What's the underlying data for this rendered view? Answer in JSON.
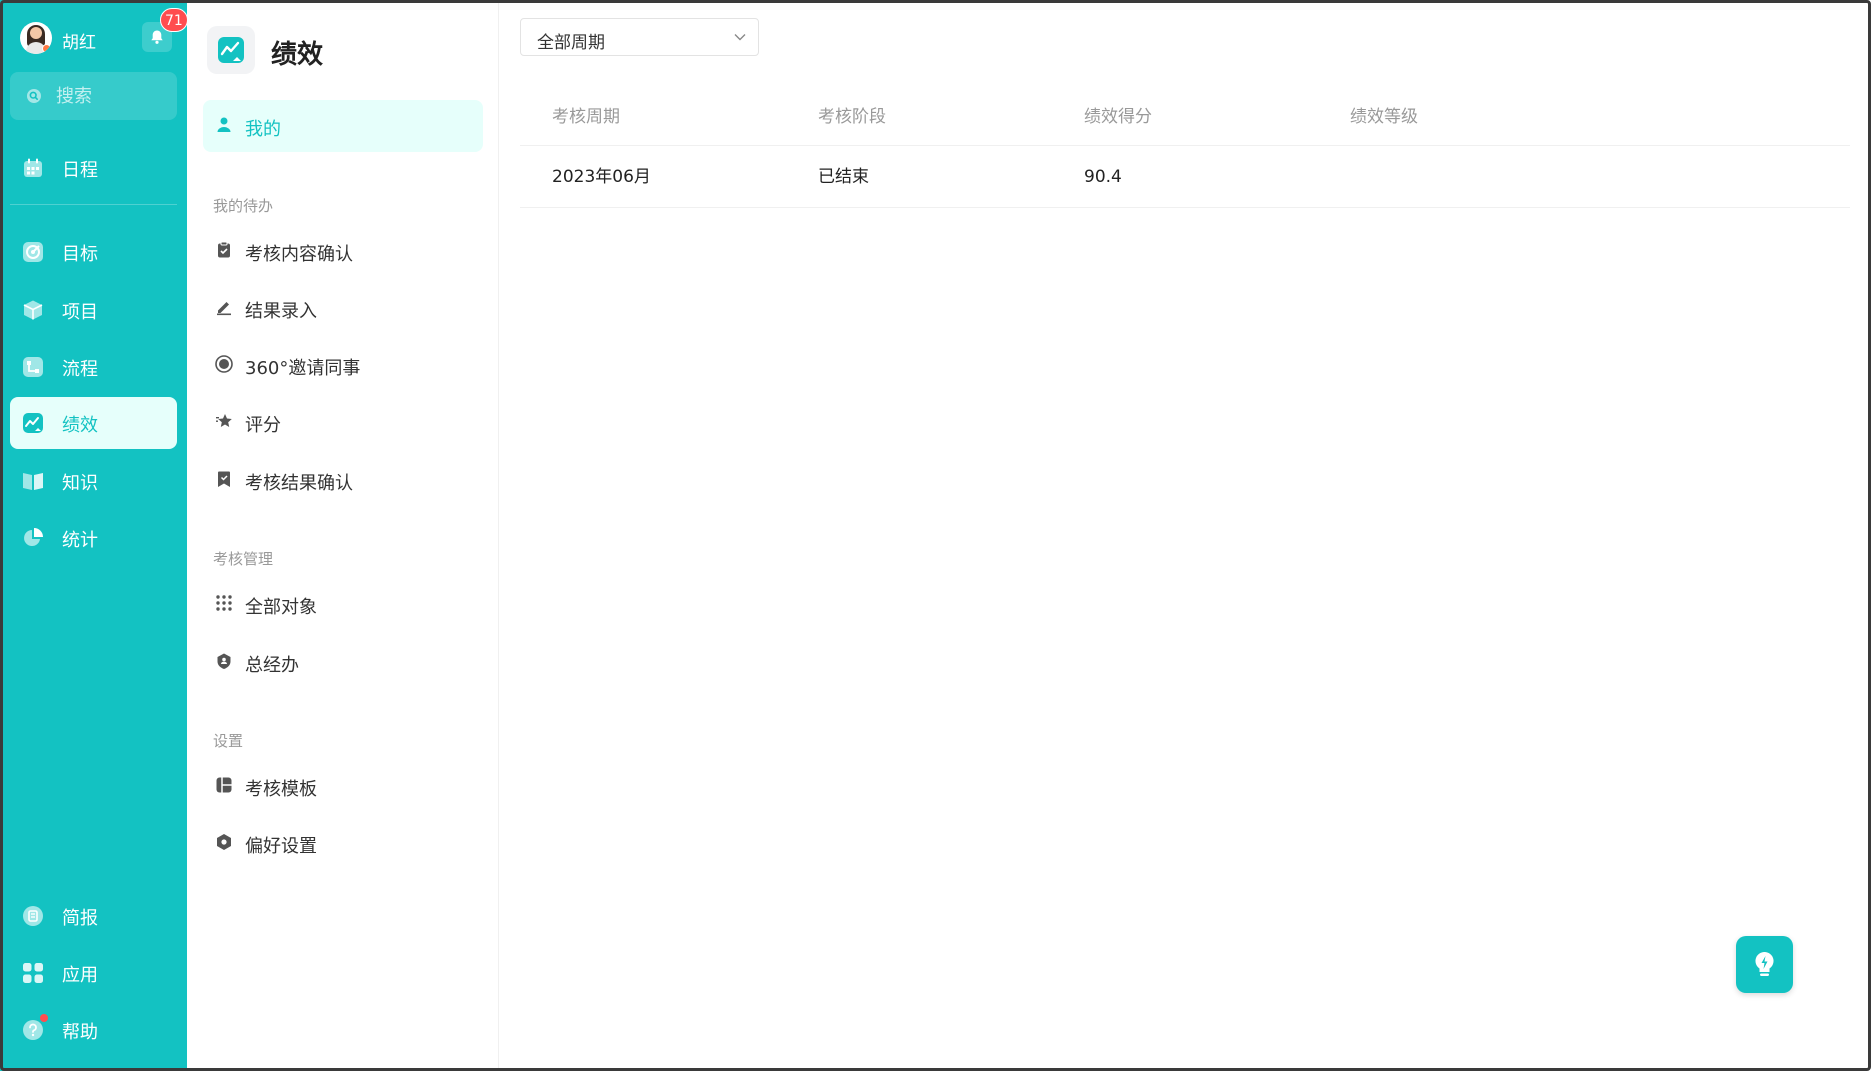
{
  "user": {
    "name": "胡红",
    "notification_count": "71"
  },
  "search": {
    "placeholder": "搜索"
  },
  "nav": {
    "schedule": "日程",
    "goals": "目标",
    "projects": "项目",
    "workflow": "流程",
    "performance": "绩效",
    "knowledge": "知识",
    "statistics": "统计",
    "briefing": "简报",
    "apps": "应用",
    "help": "帮助"
  },
  "module": {
    "title": "绩效"
  },
  "sub_nav": {
    "mine": "我的",
    "todo_group": "我的待办",
    "todo_items": [
      "考核内容确认",
      "结果录入",
      "360°邀请同事",
      "评分",
      "考核结果确认"
    ],
    "manage_group": "考核管理",
    "manage_items": [
      "全部对象",
      "总经办"
    ],
    "settings_group": "设置",
    "settings_items": [
      "考核模板",
      "偏好设置"
    ]
  },
  "filter": {
    "period_selected": "全部周期"
  },
  "table": {
    "headers": [
      "考核周期",
      "考核阶段",
      "绩效得分",
      "绩效等级"
    ],
    "rows": [
      {
        "period": "2023年06月",
        "stage": "已结束",
        "score": "90.4",
        "grade": ""
      }
    ]
  },
  "colors": {
    "accent": "#13c2c2",
    "active_bg": "#e6fffb",
    "badge": "#ff4d4f"
  }
}
